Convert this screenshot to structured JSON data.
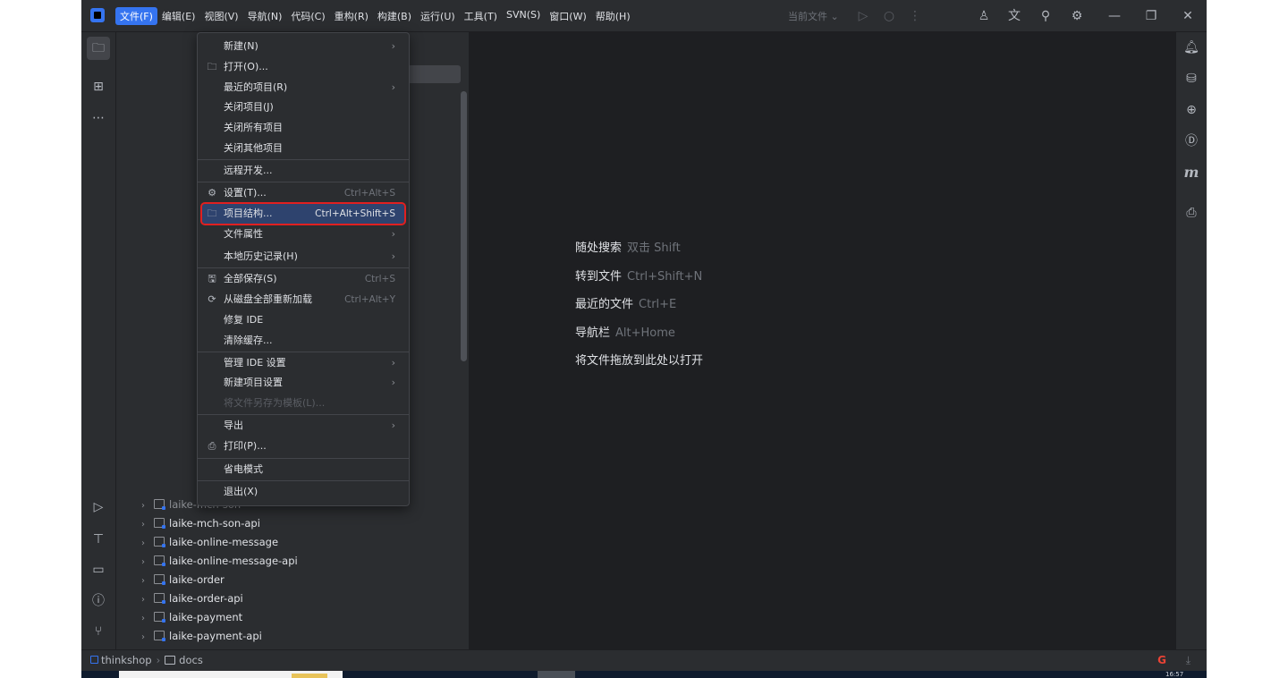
{
  "menubar": {
    "items": [
      "文件(F)",
      "编辑(E)",
      "视图(V)",
      "导航(N)",
      "代码(C)",
      "重构(R)",
      "构建(B)",
      "运行(U)",
      "工具(T)",
      "SVN(S)",
      "窗口(W)",
      "帮助(H)"
    ],
    "active_index": 0
  },
  "toolbar": {
    "current_file": "当前文件 ⌄",
    "window_controls": [
      "minimize-icon",
      "restore-icon",
      "close-icon"
    ]
  },
  "left_strip": [
    "project-folder-icon",
    "structure-icon",
    "more-icon",
    "run-icon",
    "build-icon",
    "terminal-icon",
    "problems-icon",
    "git-icon"
  ],
  "right_strip": [
    "notifications-icon",
    "database-icon",
    "web-icon",
    "d-plugin-icon",
    "maven-icon",
    "bookmark-icon"
  ],
  "file_menu": {
    "items": [
      {
        "label": "新建(N)",
        "icon": "",
        "shortcut": "",
        "submenu": true
      },
      {
        "label": "打开(O)...",
        "icon": "folder-icon",
        "shortcut": "",
        "submenu": false
      },
      {
        "label": "最近的项目(R)",
        "icon": "",
        "shortcut": "",
        "submenu": true
      },
      {
        "label": "关闭项目(J)",
        "icon": "",
        "shortcut": "",
        "submenu": false
      },
      {
        "label": "关闭所有项目",
        "icon": "",
        "shortcut": "",
        "submenu": false
      },
      {
        "label": "关闭其他项目",
        "icon": "",
        "shortcut": "",
        "submenu": false
      },
      {
        "label": "远程开发...",
        "icon": "",
        "shortcut": "",
        "submenu": false
      },
      {
        "label": "设置(T)...",
        "icon": "gear-icon",
        "shortcut": "Ctrl+Alt+S",
        "submenu": false
      },
      {
        "label": "项目结构...",
        "icon": "project-structure-icon",
        "shortcut": "Ctrl+Alt+Shift+S",
        "submenu": false,
        "highlighted": true
      },
      {
        "label": "文件属性",
        "icon": "",
        "shortcut": "",
        "submenu": true
      },
      {
        "label": "本地历史记录(H)",
        "icon": "",
        "shortcut": "",
        "submenu": true
      },
      {
        "label": "全部保存(S)",
        "icon": "save-icon",
        "shortcut": "Ctrl+S",
        "submenu": false
      },
      {
        "label": "从磁盘全部重新加载",
        "icon": "reload-icon",
        "shortcut": "Ctrl+Alt+Y",
        "submenu": false
      },
      {
        "label": "修复 IDE",
        "icon": "",
        "shortcut": "",
        "submenu": false
      },
      {
        "label": "清除缓存...",
        "icon": "",
        "shortcut": "",
        "submenu": false
      },
      {
        "label": "管理 IDE 设置",
        "icon": "",
        "shortcut": "",
        "submenu": true
      },
      {
        "label": "新建项目设置",
        "icon": "",
        "shortcut": "",
        "submenu": true
      },
      {
        "label": "将文件另存为模板(L)...",
        "icon": "",
        "shortcut": "",
        "submenu": false,
        "disabled": true
      },
      {
        "label": "导出",
        "icon": "",
        "shortcut": "",
        "submenu": true
      },
      {
        "label": "打印(P)...",
        "icon": "print-icon",
        "shortcut": "",
        "submenu": false
      },
      {
        "label": "省电模式",
        "icon": "",
        "shortcut": "",
        "submenu": false
      },
      {
        "label": "退出(X)",
        "icon": "",
        "shortcut": "",
        "submenu": false
      }
    ]
  },
  "project_tree": {
    "partial_row": "laike-mch-son",
    "rows": [
      "laike-mch-son-api",
      "laike-online-message",
      "laike-online-message-api",
      "laike-order",
      "laike-order-api",
      "laike-payment",
      "laike-payment-api"
    ]
  },
  "editor_hints": [
    {
      "label": "随处搜索",
      "shortcut": "双击 Shift"
    },
    {
      "label": "转到文件",
      "shortcut": "Ctrl+Shift+N"
    },
    {
      "label": "最近的文件",
      "shortcut": "Ctrl+E"
    },
    {
      "label": "导航栏",
      "shortcut": "Alt+Home"
    },
    {
      "label": "将文件拖放到此处以打开",
      "shortcut": ""
    }
  ],
  "statusbar": {
    "project": "thinkshop",
    "folder": "docs"
  },
  "taskbar": {
    "time": "16:57"
  },
  "colors": {
    "accent": "#3574f0",
    "highlight_border": "#e02020",
    "panel_bg": "#2b2d30",
    "editor_bg": "#1e1f22"
  }
}
